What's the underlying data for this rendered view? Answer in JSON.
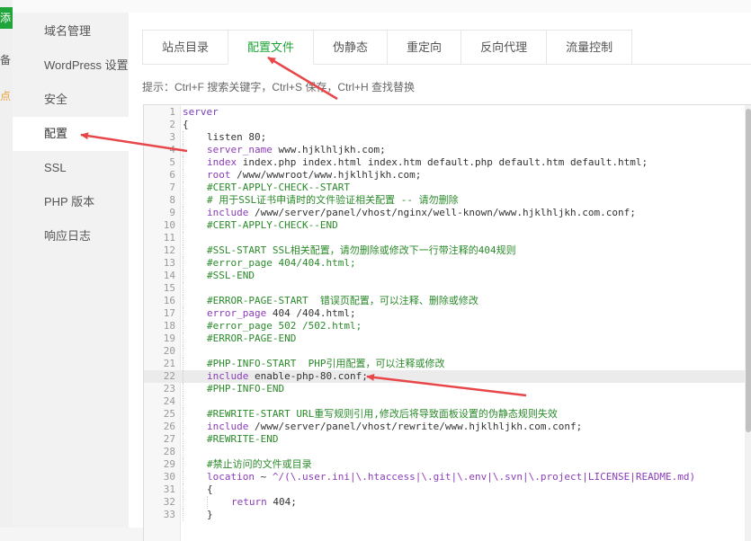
{
  "background_page": {
    "add_button_label": "添",
    "text1": "备",
    "text2": "点"
  },
  "sidebar": {
    "items": [
      {
        "label": "域名管理"
      },
      {
        "label": "WordPress 设置"
      },
      {
        "label": "安全"
      },
      {
        "label": "配置"
      },
      {
        "label": "SSL"
      },
      {
        "label": "PHP 版本"
      },
      {
        "label": "响应日志"
      }
    ],
    "active_index": 3
  },
  "tabs": {
    "items": [
      {
        "label": "站点目录"
      },
      {
        "label": "配置文件"
      },
      {
        "label": "伪静态"
      },
      {
        "label": "重定向"
      },
      {
        "label": "反向代理"
      },
      {
        "label": "流量控制"
      }
    ],
    "active_index": 1
  },
  "hint": "提示：Ctrl+F 搜索关键字，Ctrl+S 保存，Ctrl+H 查找替换",
  "editor": {
    "current_line": 22,
    "lines": [
      {
        "n": "1",
        "indent": 0,
        "segs": [
          {
            "t": "server",
            "c": "k"
          }
        ]
      },
      {
        "n": "2",
        "indent": 0,
        "segs": [
          {
            "t": "{"
          }
        ]
      },
      {
        "n": "3",
        "indent": 1,
        "segs": [
          {
            "t": "listen 80;"
          }
        ]
      },
      {
        "n": "4",
        "indent": 1,
        "segs": [
          {
            "t": "server_name",
            "c": "d"
          },
          {
            "t": " www.hjklhljkh.com;"
          }
        ]
      },
      {
        "n": "5",
        "indent": 1,
        "segs": [
          {
            "t": "index",
            "c": "d"
          },
          {
            "t": " index.php index.html index.htm default.php default.htm default.html;"
          }
        ]
      },
      {
        "n": "6",
        "indent": 1,
        "segs": [
          {
            "t": "root",
            "c": "d"
          },
          {
            "t": " /www/wwwroot/www.hjklhljkh.com;"
          }
        ]
      },
      {
        "n": "7",
        "indent": 1,
        "segs": [
          {
            "t": "#CERT-APPLY-CHECK--START",
            "c": "c"
          }
        ]
      },
      {
        "n": "8",
        "indent": 1,
        "segs": [
          {
            "t": "# 用于SSL证书申请时的文件验证相关配置 -- 请勿删除",
            "c": "c"
          }
        ]
      },
      {
        "n": "9",
        "indent": 1,
        "segs": [
          {
            "t": "include",
            "c": "d"
          },
          {
            "t": " /www/server/panel/vhost/nginx/well-known/www.hjklhljkh.com.conf;"
          }
        ]
      },
      {
        "n": "10",
        "indent": 1,
        "segs": [
          {
            "t": "#CERT-APPLY-CHECK--END",
            "c": "c"
          }
        ]
      },
      {
        "n": "11",
        "indent": 1,
        "segs": []
      },
      {
        "n": "12",
        "indent": 1,
        "segs": [
          {
            "t": "#SSL-START SSL相关配置，请勿删除或修改下一行带注释的404规则",
            "c": "c"
          }
        ]
      },
      {
        "n": "13",
        "indent": 1,
        "segs": [
          {
            "t": "#error_page 404/404.html;",
            "c": "c"
          }
        ]
      },
      {
        "n": "14",
        "indent": 1,
        "segs": [
          {
            "t": "#SSL-END",
            "c": "c"
          }
        ]
      },
      {
        "n": "15",
        "indent": 1,
        "segs": []
      },
      {
        "n": "16",
        "indent": 1,
        "segs": [
          {
            "t": "#ERROR-PAGE-START  错误页配置，可以注释、删除或修改",
            "c": "c"
          }
        ]
      },
      {
        "n": "17",
        "indent": 1,
        "segs": [
          {
            "t": "error_page",
            "c": "d"
          },
          {
            "t": " 404 /404.html;"
          }
        ]
      },
      {
        "n": "18",
        "indent": 1,
        "segs": [
          {
            "t": "#error_page 502 /502.html;",
            "c": "c"
          }
        ]
      },
      {
        "n": "19",
        "indent": 1,
        "segs": [
          {
            "t": "#ERROR-PAGE-END",
            "c": "c"
          }
        ]
      },
      {
        "n": "20",
        "indent": 1,
        "segs": []
      },
      {
        "n": "21",
        "indent": 1,
        "segs": [
          {
            "t": "#PHP-INFO-START  PHP引用配置，可以注释或修改",
            "c": "c"
          }
        ]
      },
      {
        "n": "22",
        "indent": 1,
        "segs": [
          {
            "t": "include",
            "c": "d"
          },
          {
            "t": " enable-php-80.conf;"
          }
        ]
      },
      {
        "n": "23",
        "indent": 1,
        "segs": [
          {
            "t": "#PHP-INFO-END",
            "c": "c"
          }
        ]
      },
      {
        "n": "24",
        "indent": 1,
        "segs": []
      },
      {
        "n": "25",
        "indent": 1,
        "segs": [
          {
            "t": "#REWRITE-START URL重写规则引用,修改后将导致面板设置的伪静态规则失效",
            "c": "c"
          }
        ]
      },
      {
        "n": "26",
        "indent": 1,
        "segs": [
          {
            "t": "include",
            "c": "d"
          },
          {
            "t": " /www/server/panel/vhost/rewrite/www.hjklhljkh.com.conf;"
          }
        ]
      },
      {
        "n": "27",
        "indent": 1,
        "segs": [
          {
            "t": "#REWRITE-END",
            "c": "c"
          }
        ]
      },
      {
        "n": "28",
        "indent": 1,
        "segs": []
      },
      {
        "n": "29",
        "indent": 1,
        "segs": [
          {
            "t": "#禁止访问的文件或目录",
            "c": "c"
          }
        ]
      },
      {
        "n": "30",
        "indent": 1,
        "segs": [
          {
            "t": "location",
            "c": "d"
          },
          {
            "t": " ~ "
          },
          {
            "t": "^/(\\.user.ini|\\.htaccess|\\.git|\\.env|\\.svn|\\.project|LICENSE|README.md)",
            "c": "d"
          }
        ]
      },
      {
        "n": "31",
        "indent": 1,
        "segs": [
          {
            "t": "{"
          }
        ]
      },
      {
        "n": "32",
        "indent": 2,
        "segs": [
          {
            "t": "return",
            "c": "d"
          },
          {
            "t": " 404;"
          }
        ]
      },
      {
        "n": "33",
        "indent": 1,
        "segs": [
          {
            "t": "}"
          }
        ]
      }
    ]
  },
  "colors": {
    "accent": "#20a53a",
    "annotation_arrow": "#e8474a"
  }
}
